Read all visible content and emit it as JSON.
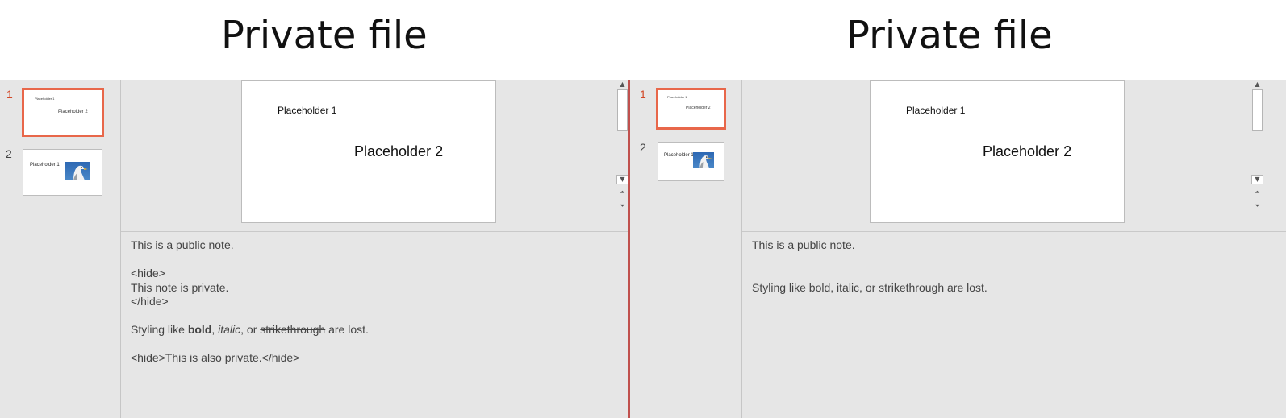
{
  "left": {
    "title": "Private file",
    "thumbnails": [
      {
        "number": "1",
        "ph1": "Placeholder 1",
        "ph2": "Placeholder 2"
      },
      {
        "number": "2",
        "ph1": "Placeholder 1"
      }
    ],
    "slide": {
      "ph1": "Placeholder 1",
      "ph2": "Placeholder 2"
    },
    "notes": {
      "line1": "This is a public note.",
      "line2": "<hide>",
      "line3": "This note is private.",
      "line4": "</hide>",
      "styling": {
        "prefix": "Styling like ",
        "bold": "bold",
        "sep1": ", ",
        "italic": "italic",
        "sep2": ", or ",
        "strike": "strikethrough",
        "suffix": " are lost."
      },
      "line6": "<hide>This is also private.</hide>"
    }
  },
  "right": {
    "title": "Private file",
    "thumbnails": [
      {
        "number": "1",
        "ph1": "Placeholder 1",
        "ph2": "Placeholder 2"
      },
      {
        "number": "2",
        "ph1": "Placeholder 1"
      }
    ],
    "slide": {
      "ph1": "Placeholder 1",
      "ph2": "Placeholder 2"
    },
    "notes": {
      "line1": "This is a public note.",
      "line2": "Styling like bold, italic, or strikethrough are lost."
    }
  },
  "colors": {
    "accent": "#e8674a",
    "divider": "#c0504d",
    "pane_bg": "#e6e6e6"
  },
  "icons": [
    "scroll-up-icon",
    "scroll-down-icon",
    "previous-slide-icon",
    "next-slide-icon",
    "seagull-image"
  ]
}
